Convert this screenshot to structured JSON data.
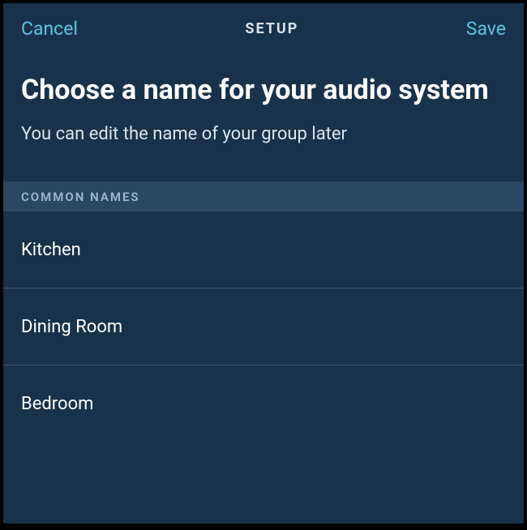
{
  "header": {
    "cancel_label": "Cancel",
    "title": "SETUP",
    "save_label": "Save"
  },
  "main": {
    "title": "Choose a name for your audio system",
    "subtitle": "You can edit the name of your group later"
  },
  "section": {
    "header": "COMMON NAMES",
    "items": [
      {
        "label": "Kitchen"
      },
      {
        "label": "Dining Room"
      },
      {
        "label": "Bedroom"
      }
    ]
  }
}
